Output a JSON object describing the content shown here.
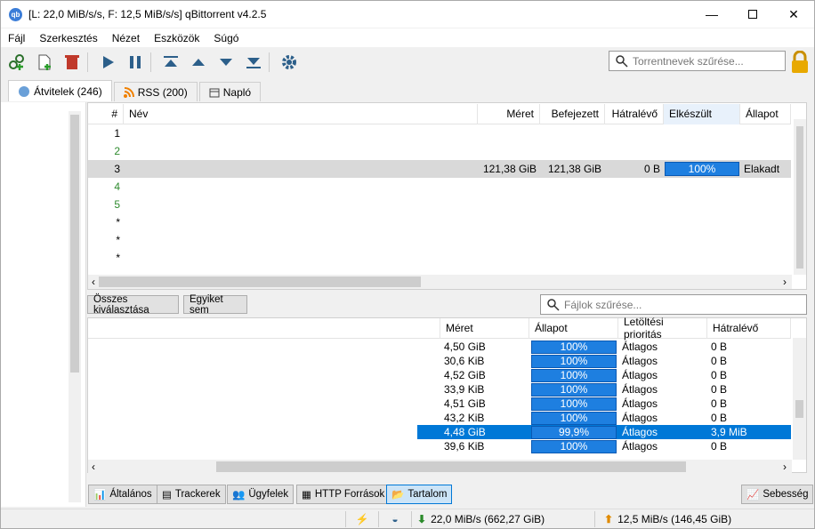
{
  "window": {
    "title": "[L: 22,0 MiB/s/s, F: 12,5 MiB/s/s] qBittorrent v4.2.5",
    "app_icon": "qb"
  },
  "menu": [
    "Fájl",
    "Szerkesztés",
    "Nézet",
    "Eszközök",
    "Súgó"
  ],
  "toolbar": {
    "filter_placeholder": "Torrentnevek szűrése..."
  },
  "tabs": [
    {
      "label": "Átvitelek (246)"
    },
    {
      "label": "RSS (200)"
    },
    {
      "label": "Napló"
    }
  ],
  "torrents": {
    "headers": [
      "#",
      "Név",
      "Méret",
      "Befejezett",
      "Hátralévő",
      "Elkészült",
      "Állapot"
    ],
    "rows": [
      {
        "num": "1",
        "size": "",
        "done": "",
        "left": "",
        "progress": "",
        "status": ""
      },
      {
        "num": "2",
        "size": "",
        "done": "",
        "left": "",
        "progress": "",
        "status": ""
      },
      {
        "num": "3",
        "size": "121,38 GiB",
        "done": "121,38 GiB",
        "left": "0 B",
        "progress": "100%",
        "status": "Elakadt"
      },
      {
        "num": "4",
        "size": "",
        "done": "",
        "left": "",
        "progress": "",
        "status": ""
      },
      {
        "num": "5",
        "size": "",
        "done": "",
        "left": "",
        "progress": "",
        "status": ""
      },
      {
        "num": "*",
        "size": "",
        "done": "",
        "left": "",
        "progress": "",
        "status": ""
      },
      {
        "num": "*",
        "size": "",
        "done": "",
        "left": "",
        "progress": "",
        "status": ""
      },
      {
        "num": "*",
        "size": "",
        "done": "",
        "left": "",
        "progress": "",
        "status": ""
      }
    ]
  },
  "files": {
    "select_all": "Összes kiválasztása",
    "select_none": "Egyiket sem",
    "filter_placeholder": "Fájlok szűrése...",
    "headers": [
      "Méret",
      "Állapot",
      "Letöltési prioritás",
      "Hátralévő"
    ],
    "rows": [
      {
        "size": "4,50 GiB",
        "progress": "100%",
        "priority": "Átlagos",
        "left": "0 B"
      },
      {
        "size": "30,6 KiB",
        "progress": "100%",
        "priority": "Átlagos",
        "left": "0 B"
      },
      {
        "size": "4,52 GiB",
        "progress": "100%",
        "priority": "Átlagos",
        "left": "0 B"
      },
      {
        "size": "33,9 KiB",
        "progress": "100%",
        "priority": "Átlagos",
        "left": "0 B"
      },
      {
        "size": "4,51 GiB",
        "progress": "100%",
        "priority": "Átlagos",
        "left": "0 B"
      },
      {
        "size": "43,2 KiB",
        "progress": "100%",
        "priority": "Átlagos",
        "left": "0 B"
      },
      {
        "size": "4,48 GiB",
        "progress": "99,9%",
        "priority": "Átlagos",
        "left": "3,9 MiB"
      },
      {
        "size": "39,6 KiB",
        "progress": "100%",
        "priority": "Átlagos",
        "left": "0 B"
      }
    ]
  },
  "bottom_tabs": [
    "Általános",
    "Trackerek",
    "Ügyfelek",
    "HTTP Források",
    "Tartalom"
  ],
  "speed_button": "Sebesség",
  "status": {
    "download": "22,0 MiB/s (662,27 GiB)",
    "upload": "12,5 MiB/s (146,45 GiB)"
  },
  "colors": {
    "accent": "#1e7fe0",
    "selected_row": "#0078d7",
    "green_num": "#2e8b2e"
  }
}
